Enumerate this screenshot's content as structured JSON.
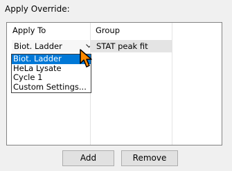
{
  "title": "Apply Override:",
  "columns": {
    "apply_to": "Apply To",
    "group": "Group"
  },
  "row": {
    "apply_to_value": "Biot. Ladder",
    "group_value": "STAT peak fit"
  },
  "dropdown": {
    "options": [
      "Biot. Ladder",
      "HeLa Lysate",
      "Cycle 1",
      "Custom Settings..."
    ],
    "selected_index": 0
  },
  "buttons": {
    "add": "Add",
    "remove": "Remove"
  },
  "colors": {
    "selection": "#0078d7",
    "background": "#f0f0f0",
    "cursor": "#ff8a00"
  },
  "icons": {
    "dropdown": "chevron-down-icon",
    "pointer": "mouse-pointer-icon"
  }
}
